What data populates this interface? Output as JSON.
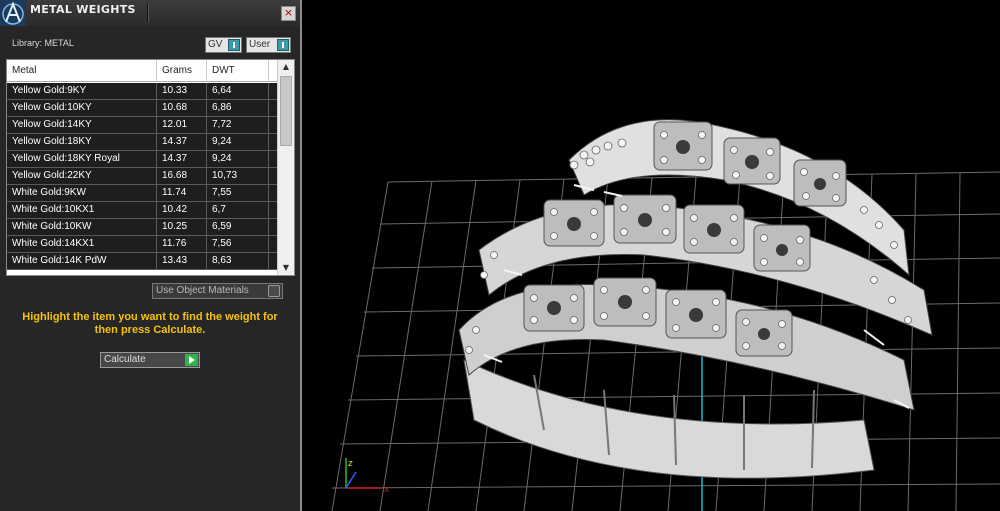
{
  "window": {
    "title": "METAL WEIGHTS",
    "close_glyph": "×"
  },
  "library": {
    "label": "Library: METAL",
    "gv_label": "GV",
    "user_label": "User"
  },
  "table": {
    "headers": [
      "Metal",
      "Grams",
      "DWT"
    ],
    "rows": [
      [
        "Yellow Gold:9KY",
        "10.33",
        "6,64"
      ],
      [
        "Yellow Gold:10KY",
        "10.68",
        "6,86"
      ],
      [
        "Yellow Gold:14KY",
        "12.01",
        "7,72"
      ],
      [
        "Yellow Gold:18KY",
        "14.37",
        "9,24"
      ],
      [
        "Yellow Gold:18KY Royal",
        "14.37",
        "9,24"
      ],
      [
        "Yellow Gold:22KY",
        "16.68",
        "10,73"
      ],
      [
        "White Gold:9KW",
        "11.74",
        "7,55"
      ],
      [
        "White Gold:10KX1",
        "10.42",
        "6,7"
      ],
      [
        "White Gold:10KW",
        "10.25",
        "6,59"
      ],
      [
        "White Gold:14KX1",
        "11.76",
        "7,56"
      ],
      [
        "White Gold:14K PdW",
        "13.43",
        "8,63"
      ]
    ]
  },
  "use_object_materials_label": "Use Object Materials",
  "hint_text": "Highlight the item you want to find the weight for then press Calculate.",
  "calculate_label": "Calculate",
  "icons": {
    "app_logo": "app-logo-icon",
    "close": "close-icon",
    "scroll_up": "chevron-up-icon",
    "scroll_down": "chevron-down-icon",
    "calculate_go": "play-icon",
    "axis_gizmo": "axis-gizmo-icon"
  },
  "colors": {
    "panel_bg": "#262626",
    "hint": "#f4c20d",
    "toggle_accent": "#3a9aa8",
    "go_green": "#2eb04a",
    "grid": "#6a6a6a",
    "axis_cyan": "#1ab8c8"
  }
}
